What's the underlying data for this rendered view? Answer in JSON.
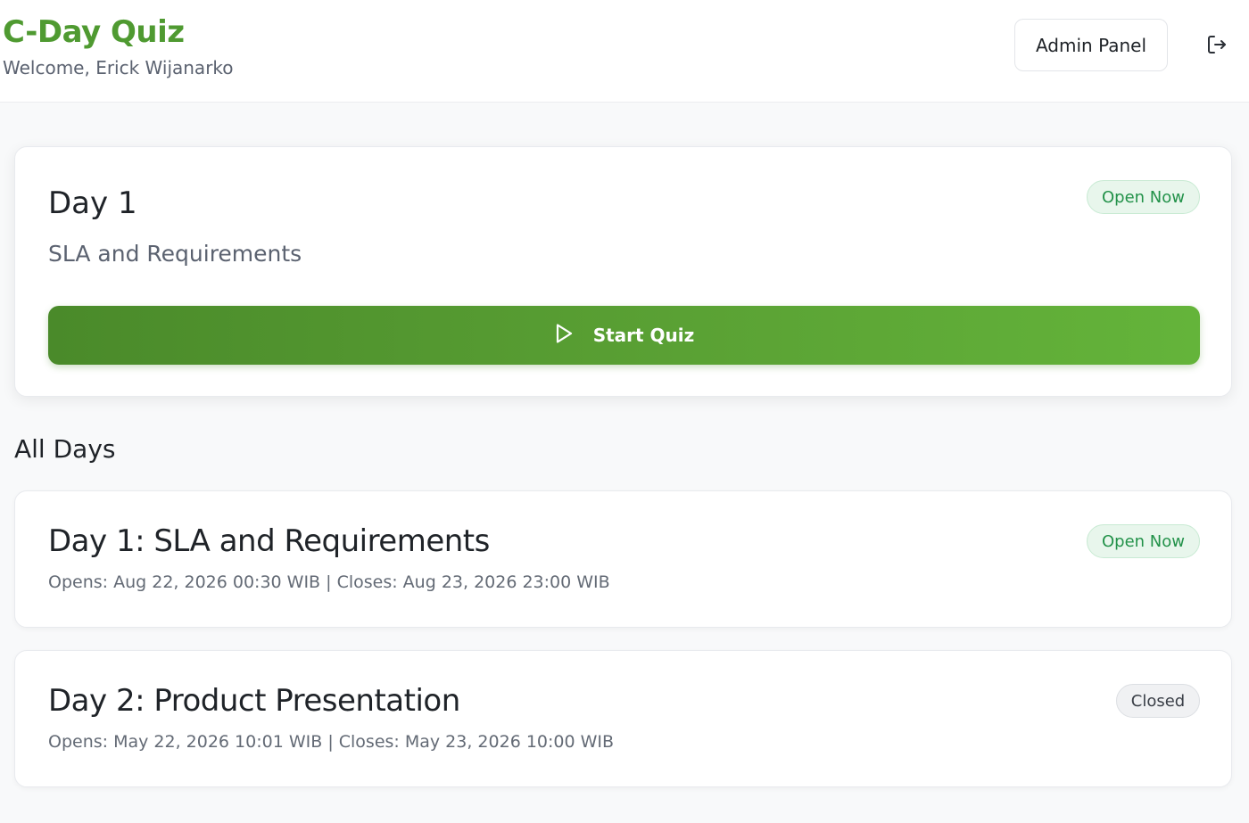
{
  "header": {
    "title": "C-Day Quiz",
    "welcome": "Welcome, Erick Wijanarko",
    "admin_label": "Admin Panel",
    "logout_icon": "logout-icon"
  },
  "current": {
    "title": "Day 1",
    "subtitle": "SLA and Requirements",
    "status": "Open Now",
    "start_label": "Start Quiz",
    "start_icon": "play-icon"
  },
  "all_days": {
    "title": "All Days",
    "days": [
      {
        "title": "Day 1: SLA and Requirements",
        "meta": "Opens: Aug 22, 2026 00:30 WIB | Closes: Aug 23, 2026 23:00 WIB",
        "status": "Open Now"
      },
      {
        "title": "Day 2: Product Presentation",
        "meta": "Opens: May 22, 2026 10:01 WIB | Closes: May 23, 2026 10:00 WIB",
        "status": "Closed"
      }
    ]
  },
  "colors": {
    "brand": "#4f9a31",
    "open_badge_text": "#23924a",
    "open_badge_bg": "#e8f6ec",
    "closed_badge_bg": "#f0f1f3"
  }
}
